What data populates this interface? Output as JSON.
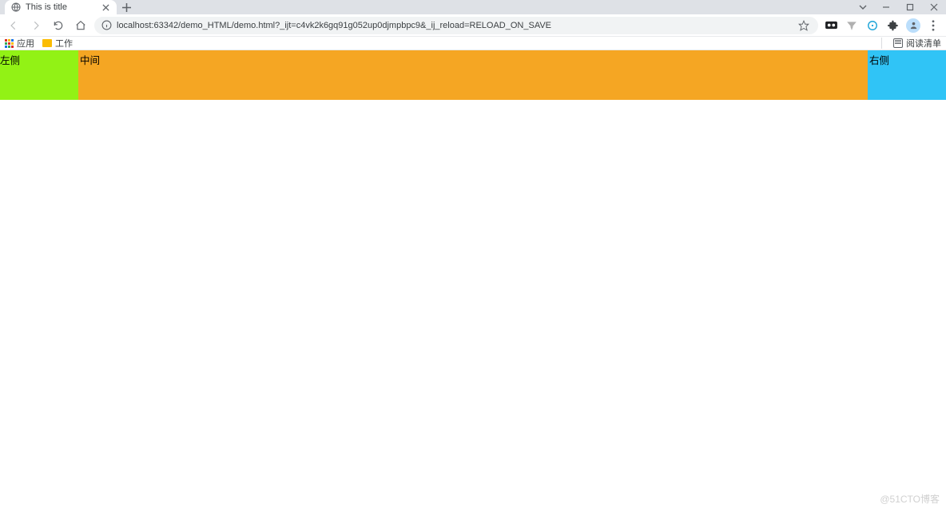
{
  "tab": {
    "title": "This is title"
  },
  "address": {
    "url": "localhost:63342/demo_HTML/demo.html?_ijt=c4vk2k6gq91g052up0djmpbpc9&_ij_reload=RELOAD_ON_SAVE"
  },
  "bookmarks": {
    "apps_label": "应用",
    "folder_label": "工作",
    "reading_list": "阅读清单"
  },
  "content": {
    "left": "左侧",
    "middle": "中间",
    "right": "右侧"
  },
  "watermark": "@51CTO博客"
}
